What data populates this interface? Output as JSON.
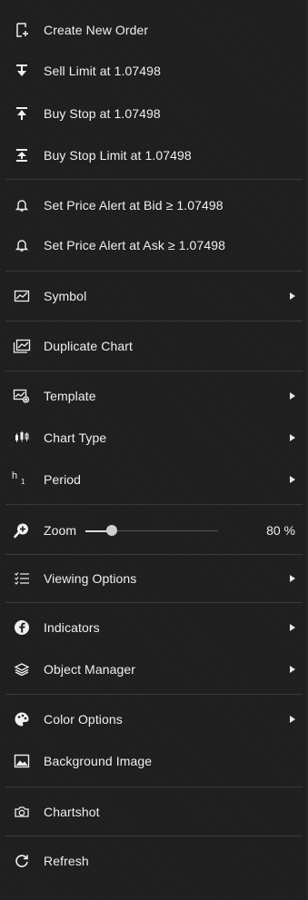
{
  "menu": {
    "create_new_order": "Create New Order",
    "sell_limit": "Sell Limit at 1.07498",
    "buy_stop": "Buy Stop at 1.07498",
    "buy_stop_limit": "Buy Stop Limit at 1.07498",
    "price_alert_bid": "Set Price Alert at Bid ≥ 1.07498",
    "price_alert_ask": "Set Price Alert at Ask ≥ 1.07498",
    "symbol": "Symbol",
    "duplicate_chart": "Duplicate Chart",
    "template": "Template",
    "chart_type": "Chart Type",
    "period": "Period",
    "period_icon_main": "h",
    "period_icon_sub": "1",
    "zoom": "Zoom",
    "zoom_value_text": "80 %",
    "zoom_level": 0.2,
    "viewing_options": "Viewing Options",
    "indicators": "Indicators",
    "object_manager": "Object Manager",
    "color_options": "Color Options",
    "background_image": "Background Image",
    "chartshot": "Chartshot",
    "refresh": "Refresh"
  },
  "colors": {
    "background": "#1e1e1e",
    "text": "#f0f0f0",
    "separator": "#3a3a3a"
  }
}
